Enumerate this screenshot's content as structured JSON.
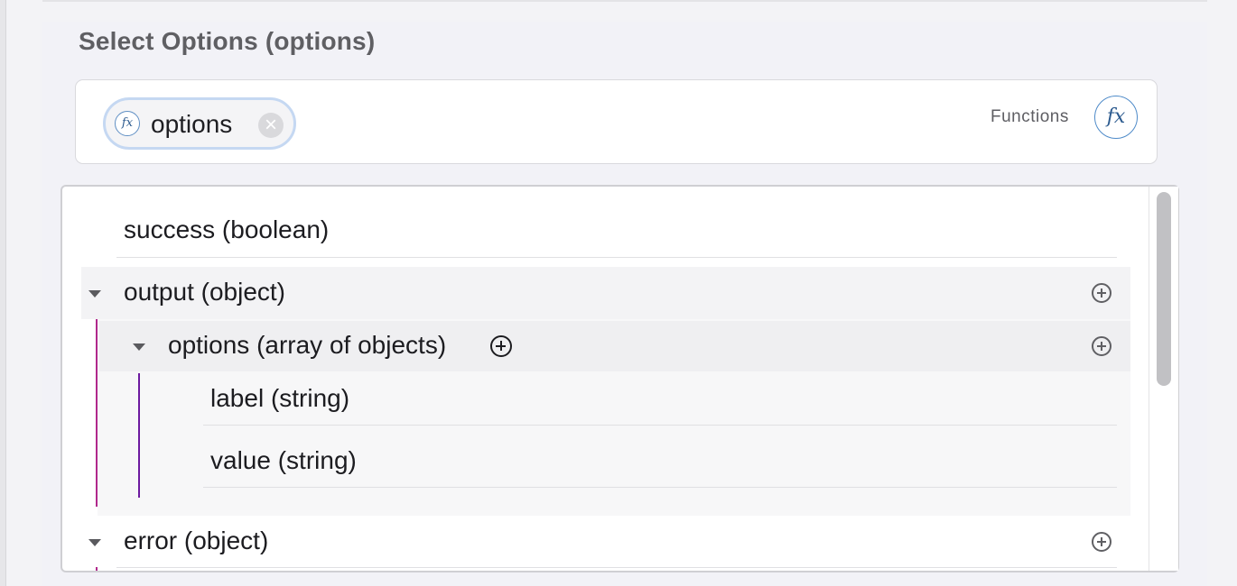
{
  "section": {
    "title": "Select Options (options)"
  },
  "selected_chip": {
    "label": "options",
    "icon": "fx-icon"
  },
  "functions": {
    "label": "Functions",
    "icon": "fx-icon",
    "glyph": "fx"
  },
  "tree": {
    "success": {
      "label": "success (boolean)"
    },
    "output": {
      "label": "output (object)",
      "expanded": true
    },
    "options": {
      "label": "options (array of objects)",
      "expanded": true
    },
    "label_field": {
      "label": "label (string)"
    },
    "value_field": {
      "label": "value (string)"
    },
    "error": {
      "label": "error (object)",
      "expanded": true
    }
  },
  "colors": {
    "output_guide": "#b0288c",
    "options_guide": "#6d1aa0",
    "fx_blue": "#2d5b8f"
  }
}
